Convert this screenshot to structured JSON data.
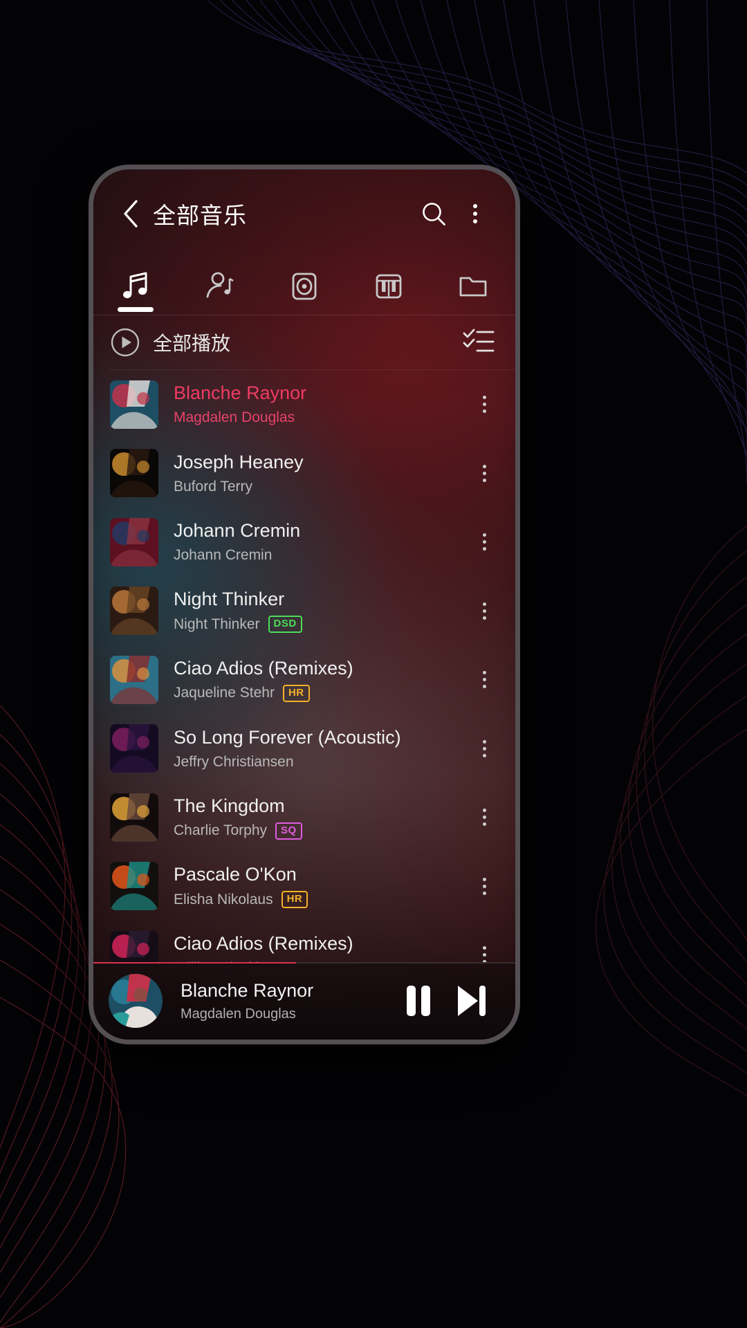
{
  "app": {
    "header": {
      "back_icon": "chevron-left-icon",
      "title": "全部音乐",
      "search_icon": "search-icon",
      "overflow_icon": "more-vertical-icon"
    },
    "tabs": [
      {
        "name": "songs",
        "icon": "music-note-icon",
        "active": true
      },
      {
        "name": "artists",
        "icon": "artist-icon",
        "active": false
      },
      {
        "name": "albums",
        "icon": "album-disc-icon",
        "active": false
      },
      {
        "name": "genres",
        "icon": "piano-keys-icon",
        "active": false
      },
      {
        "name": "folders",
        "icon": "folder-icon",
        "active": false
      }
    ],
    "play_all": {
      "icon": "play-circle-icon",
      "label": "全部播放",
      "multi_select_icon": "checklist-icon"
    },
    "songs": [
      {
        "title": "Blanche Raynor",
        "artist": "Magdalen Douglas",
        "badge": "",
        "badge_color": "",
        "playing": true,
        "art_a": "#1d4e63",
        "art_b": "#c0334a",
        "art_c": "#e8e0dc"
      },
      {
        "title": "Joseph Heaney",
        "artist": "Buford Terry",
        "badge": "",
        "badge_color": "",
        "playing": false,
        "art_a": "#0a0707",
        "art_b": "#c98b2e",
        "art_c": "#2b1a10"
      },
      {
        "title": "Johann Cremin",
        "artist": "Johann Cremin",
        "badge": "",
        "badge_color": "",
        "playing": false,
        "art_a": "#5c1020",
        "art_b": "#243a63",
        "art_c": "#8c3340"
      },
      {
        "title": "Night Thinker",
        "artist": "Night Thinker",
        "badge": "DSD",
        "badge_color": "#4ade57",
        "playing": false,
        "art_a": "#2a1a12",
        "art_b": "#b8773a",
        "art_c": "#6a4526"
      },
      {
        "title": "Ciao Adios (Remixes)",
        "artist": "Jaqueline Stehr",
        "badge": "HR",
        "badge_color": "#f2b225",
        "playing": false,
        "art_a": "#2c6f86",
        "art_b": "#d8903f",
        "art_c": "#8a2a2a"
      },
      {
        "title": "So Long Forever (Acoustic)",
        "artist": "Jeffry Christiansen",
        "badge": "",
        "badge_color": "",
        "playing": false,
        "art_a": "#140b22",
        "art_b": "#7d1f5e",
        "art_c": "#2b1440"
      },
      {
        "title": "The Kingdom",
        "artist": "Charlie Torphy",
        "badge": "SQ",
        "badge_color": "#e05ce0",
        "playing": false,
        "art_a": "#120b0c",
        "art_b": "#e0a23a",
        "art_c": "#6b4b3c"
      },
      {
        "title": "Pascale O'Kon",
        "artist": "Elisha Nikolaus",
        "badge": "HR",
        "badge_color": "#f2b225",
        "playing": false,
        "art_a": "#12100e",
        "art_b": "#e2561a",
        "art_c": "#1d8f88"
      },
      {
        "title": "Ciao Adios (Remixes)",
        "artist": "Willis Osinski",
        "badge": "",
        "badge_color": "",
        "playing": false,
        "art_a": "#140d16",
        "art_b": "#d4245a",
        "art_c": "#2a1d33"
      }
    ],
    "mini_player": {
      "title": "Blanche Raynor",
      "artist": "Magdalen Douglas",
      "progress_percent": 48,
      "pause_icon": "pause-icon",
      "next_icon": "skip-next-icon"
    },
    "colors": {
      "accent": "#ef3b62",
      "progress": "#d8344f",
      "badge_dsd": "#4ade57",
      "badge_hr": "#f2b225",
      "badge_sq": "#e05ce0"
    }
  }
}
